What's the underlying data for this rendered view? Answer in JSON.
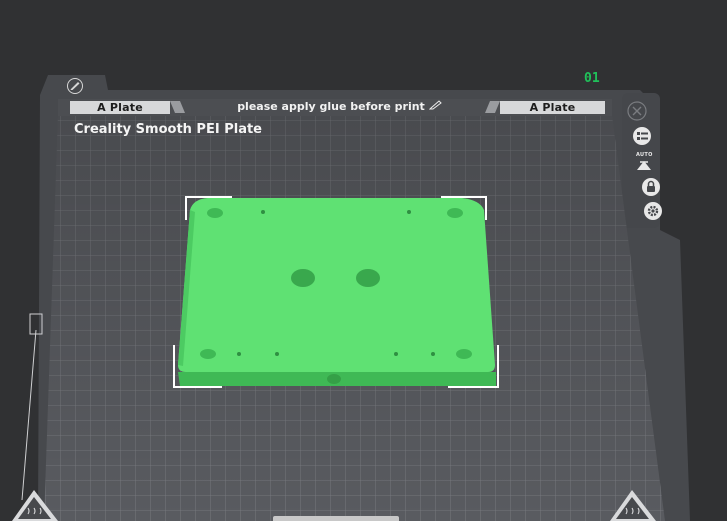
{
  "plate": {
    "left_label": "A Plate",
    "right_label": "A Plate",
    "glue_note": "please apply glue before print",
    "name": "Creality Smooth PEI Plate",
    "number": "01"
  },
  "toolbar": {
    "auto_label": "AUTO"
  },
  "colors": {
    "background": "#303133",
    "plate_frame": "#4b4d51",
    "grid_line": "#8a8c90",
    "model_green": "#5fe173",
    "plate_number": "#20c05a"
  }
}
